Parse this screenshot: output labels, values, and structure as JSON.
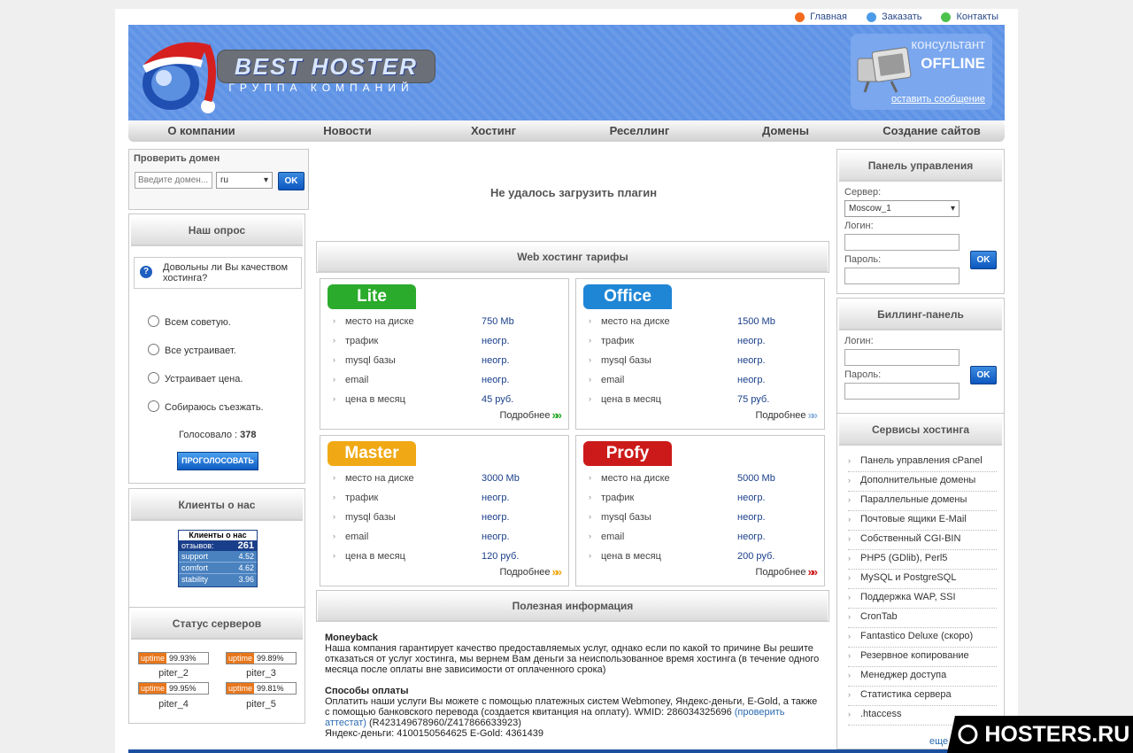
{
  "toplinks": {
    "home": "Главная",
    "order": "Заказать",
    "contacts": "Контакты"
  },
  "colors": {
    "home_dot": "#f26b1d",
    "order_dot": "#4b9be8",
    "contacts_dot": "#4cc24c",
    "header_bg": "#5f93e6"
  },
  "logo": {
    "name": "BEST HOSTER",
    "subtitle": "ГРУППА КОМПАНИЙ"
  },
  "consultant": {
    "title": "консультант",
    "status": "OFFLINE",
    "link": "оставить сообщение"
  },
  "nav": [
    "О компании",
    "Новости",
    "Хостинг",
    "Реселлинг",
    "Домены",
    "Создание сайтов"
  ],
  "domain_check": {
    "title": "Проверить домен",
    "placeholder": "Введите домен...",
    "zone": "ru",
    "ok": "OK"
  },
  "poll": {
    "title": "Наш опрос",
    "question": "Довольны ли Вы качеством хостинга?",
    "options": [
      "Всем советую.",
      "Все устраивает.",
      "Устраивает цена.",
      "Собираюсь съезжать."
    ],
    "votes_label": "Голосовало :",
    "votes": "378",
    "vote_button": "ПРОГОЛОСОВАТЬ"
  },
  "reviews": {
    "title": "Клиенты о нас",
    "widget_title": "Клиенты о нас",
    "reviews_label": "отзывов:",
    "reviews_count": "261",
    "rows": [
      {
        "k": "support",
        "v": "4.52"
      },
      {
        "k": "comfort",
        "v": "4.62"
      },
      {
        "k": "stability",
        "v": "3.96"
      }
    ]
  },
  "servers": {
    "title": "Статус серверов",
    "uptime_label": "uptime",
    "items": [
      {
        "name": "piter_2",
        "pct": "99.93%"
      },
      {
        "name": "piter_3",
        "pct": "99.89%"
      },
      {
        "name": "piter_4",
        "pct": "99.95%"
      },
      {
        "name": "piter_5",
        "pct": "99.81%"
      }
    ]
  },
  "plugin_error": "Не удалось загрузить плагин",
  "tariffs": {
    "title": "Web хостинг тарифы",
    "labels": [
      "место на диске",
      "трафик",
      "mysql базы",
      "email",
      "цена в месяц"
    ],
    "more": "Подробнее",
    "plans": [
      {
        "name": "Lite",
        "color": "#2bab2b",
        "values": [
          "750 Mb",
          "неогр.",
          "неогр.",
          "неогр.",
          "45 руб."
        ],
        "chev": "#2bab2b"
      },
      {
        "name": "Office",
        "color": "#1f86d6",
        "values": [
          "1500 Mb",
          "неогр.",
          "неогр.",
          "неогр.",
          "75 руб."
        ],
        "chev": "#8fb6dd"
      },
      {
        "name": "Master",
        "color": "#f0a915",
        "values": [
          "3000 Mb",
          "неогр.",
          "неогр.",
          "неогр.",
          "120 руб."
        ],
        "chev": "#f0a915"
      },
      {
        "name": "Profy",
        "color": "#cc1a1a",
        "values": [
          "5000 Mb",
          "неогр.",
          "неогр.",
          "неогр.",
          "200 руб."
        ],
        "chev": "#cc1a1a"
      }
    ]
  },
  "info": {
    "title": "Полезная информация",
    "moneyback_title": "Moneyback",
    "moneyback_text": "Наша компания гарантирует качество предоставляемых услуг, однако если по какой то причине Вы решите отказаться от услуг хостинга, мы вернем Вам деньги за неиспользованное время хостинга (в течение одного месяца после оплаты вне зависимости от оплаченного срока)",
    "payment_title": "Способы оплаты",
    "payment_text": "Оплатить наши услуги Вы можете с помощью платежных систем Webmoney, Яндекс-деньги, E-Gold, а также с помощью банковского перевода (создается квитанция на оплату). WMID: 286034325696",
    "payment_link": "(проверить аттестат)",
    "payment_purses": " (R423149678960/Z417866633923)",
    "payment_yandex": "Яндекс-деньги: 4100150564625 E-Gold: 4361439"
  },
  "control_panel": {
    "title": "Панель управления",
    "server_label": "Сервер:",
    "server_value": "Moscow_1",
    "login_label": "Логин:",
    "password_label": "Пароль:",
    "ok": "OK"
  },
  "billing": {
    "title": "Биллинг-панель",
    "login_label": "Логин:",
    "password_label": "Пароль:",
    "ok": "OK"
  },
  "services": {
    "title": "Сервисы хостинга",
    "items": [
      "Панель управления cPanel",
      "Дополнительные домены",
      "Параллельные домены",
      "Почтовые ящики E-Mail",
      "Собственный CGI-BIN",
      "PHP5 (GDlib), Perl5",
      "MySQL и PostgreSQL",
      "Поддержка WAP, SSI",
      "CronTab",
      "Fantastico Deluxe (скоро)",
      "Резервное копирование",
      "Менеджер доступа",
      "Статистика сервера",
      ".htaccess"
    ],
    "more": "еще"
  },
  "watermark": "HOSTERS.RU"
}
